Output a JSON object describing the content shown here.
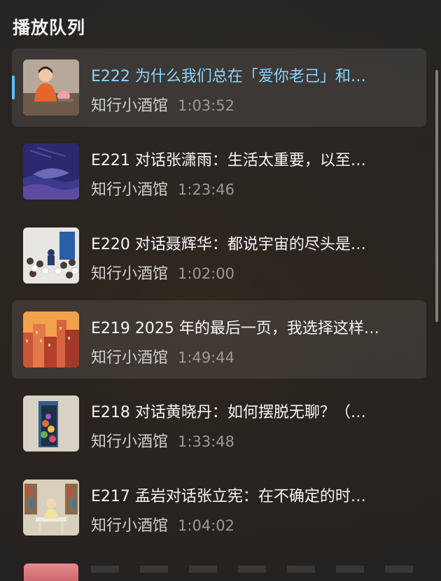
{
  "header": {
    "title": "播放队列"
  },
  "queue": [
    {
      "title": "E222 为什么我们总在「爱你老己」和…",
      "podcast": "知行小酒馆",
      "duration": "1:03:52",
      "thumb": "person-with-piggy-bank",
      "state": "active"
    },
    {
      "title": "E221 对话张潇雨：生活太重要，以至…",
      "podcast": "知行小酒馆",
      "duration": "1:23:46",
      "thumb": "whale-in-waves",
      "state": "normal"
    },
    {
      "title": "E220 对话聂辉华：都说宇宙的尽头是…",
      "podcast": "知行小酒馆",
      "duration": "1:02:00",
      "thumb": "crowd-figures",
      "state": "normal"
    },
    {
      "title": "E219 2025 年的最后一页，我选择这样…",
      "podcast": "知行小酒馆",
      "duration": "1:49:44",
      "thumb": "city-buildings",
      "state": "hover"
    },
    {
      "title": "E218 对话黄晓丹：如何摆脱无聊？（…",
      "podcast": "知行小酒馆",
      "duration": "1:33:48",
      "thumb": "door-with-flowers",
      "state": "normal"
    },
    {
      "title": "E217 孟岩对话张立宪：在不确定的时…",
      "podcast": "知行小酒馆",
      "duration": "1:04:02",
      "thumb": "person-at-desk",
      "state": "normal"
    }
  ],
  "colors": {
    "accent": "#5bc2ff",
    "active_title": "#8ed3ff"
  }
}
